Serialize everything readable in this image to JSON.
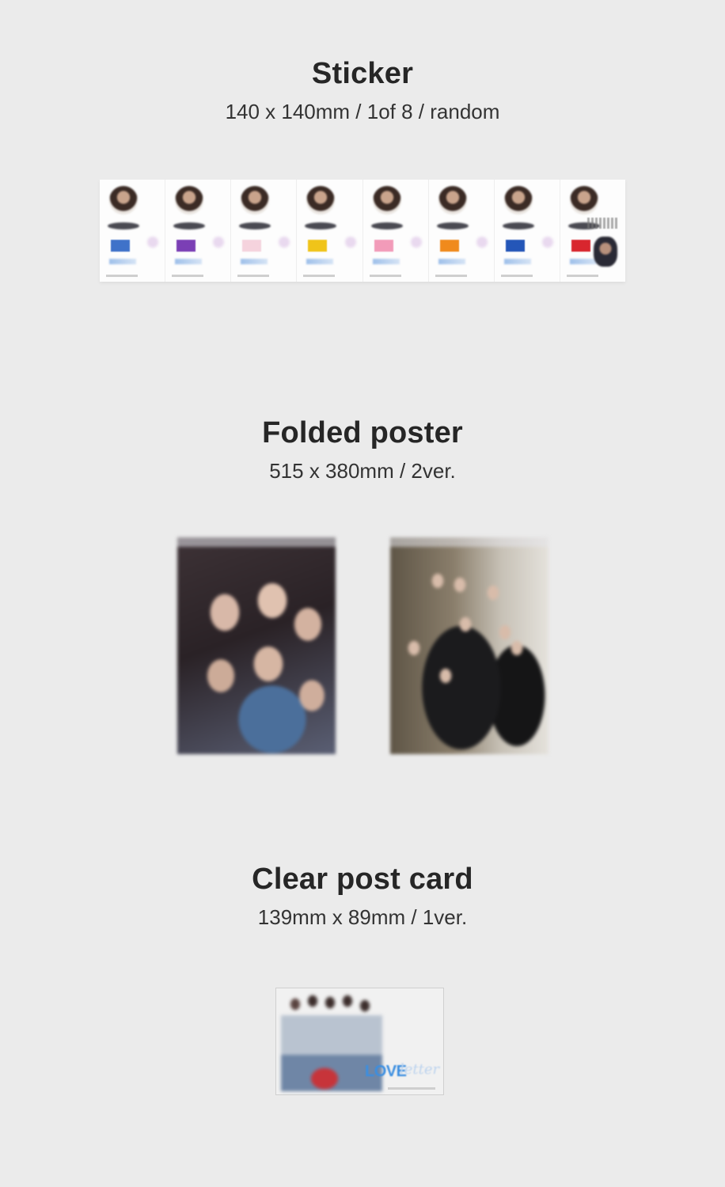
{
  "sections": {
    "sticker": {
      "title": "Sticker",
      "subtitle": "140 x 140mm / 1of 8 / random",
      "panel_colors": [
        "#3f72c9",
        "#7b3fb5",
        "#f5d3dd",
        "#f0c419",
        "#f29bb9",
        "#f08a1c",
        "#2456b8",
        "#d8262e"
      ]
    },
    "poster": {
      "title": "Folded poster",
      "subtitle": "515 x 380mm / 2ver."
    },
    "postcard": {
      "title": "Clear post card",
      "subtitle": "139mm x 89mm / 1ver.",
      "logo_text": "LOVE",
      "logo_script": "letter"
    }
  }
}
